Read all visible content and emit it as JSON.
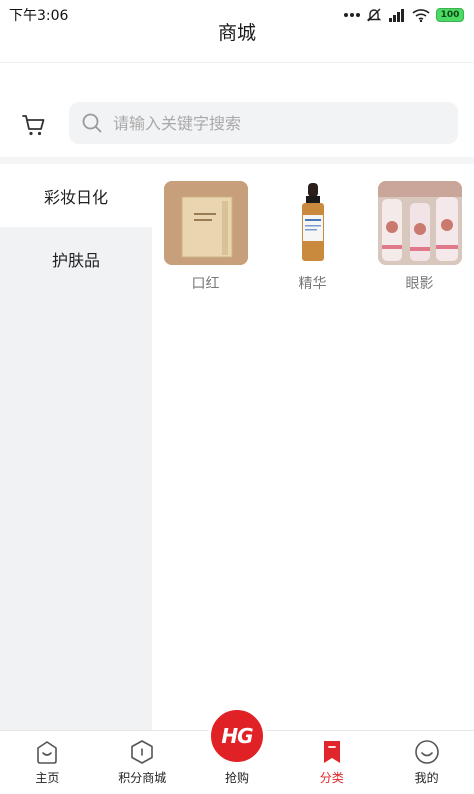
{
  "status_bar": {
    "time": "下午3:06",
    "battery": "100"
  },
  "header": {
    "title": "商城"
  },
  "search": {
    "placeholder": "请输入关键字搜索"
  },
  "categories": [
    {
      "label": "彩妆日化",
      "active": true
    },
    {
      "label": "护肤品",
      "active": false
    }
  ],
  "products": [
    {
      "name": "口红",
      "icon": "product-box-image"
    },
    {
      "name": "精华",
      "icon": "serum-bottle-image"
    },
    {
      "name": "眼影",
      "icon": "cosmetic-jars-image"
    }
  ],
  "tabs": [
    {
      "label": "主页",
      "icon": "home-bag-icon",
      "active": false
    },
    {
      "label": "积分商城",
      "icon": "hexagon-icon",
      "active": false
    },
    {
      "label": "抢购",
      "icon": "hg-logo",
      "badge_text": "HG",
      "active": false
    },
    {
      "label": "分类",
      "icon": "bookmark-icon",
      "active": true
    },
    {
      "label": "我的",
      "icon": "smile-icon",
      "active": false
    }
  ],
  "colors": {
    "accent": "#e0262a",
    "sidebar_bg": "#f1f2f4"
  }
}
